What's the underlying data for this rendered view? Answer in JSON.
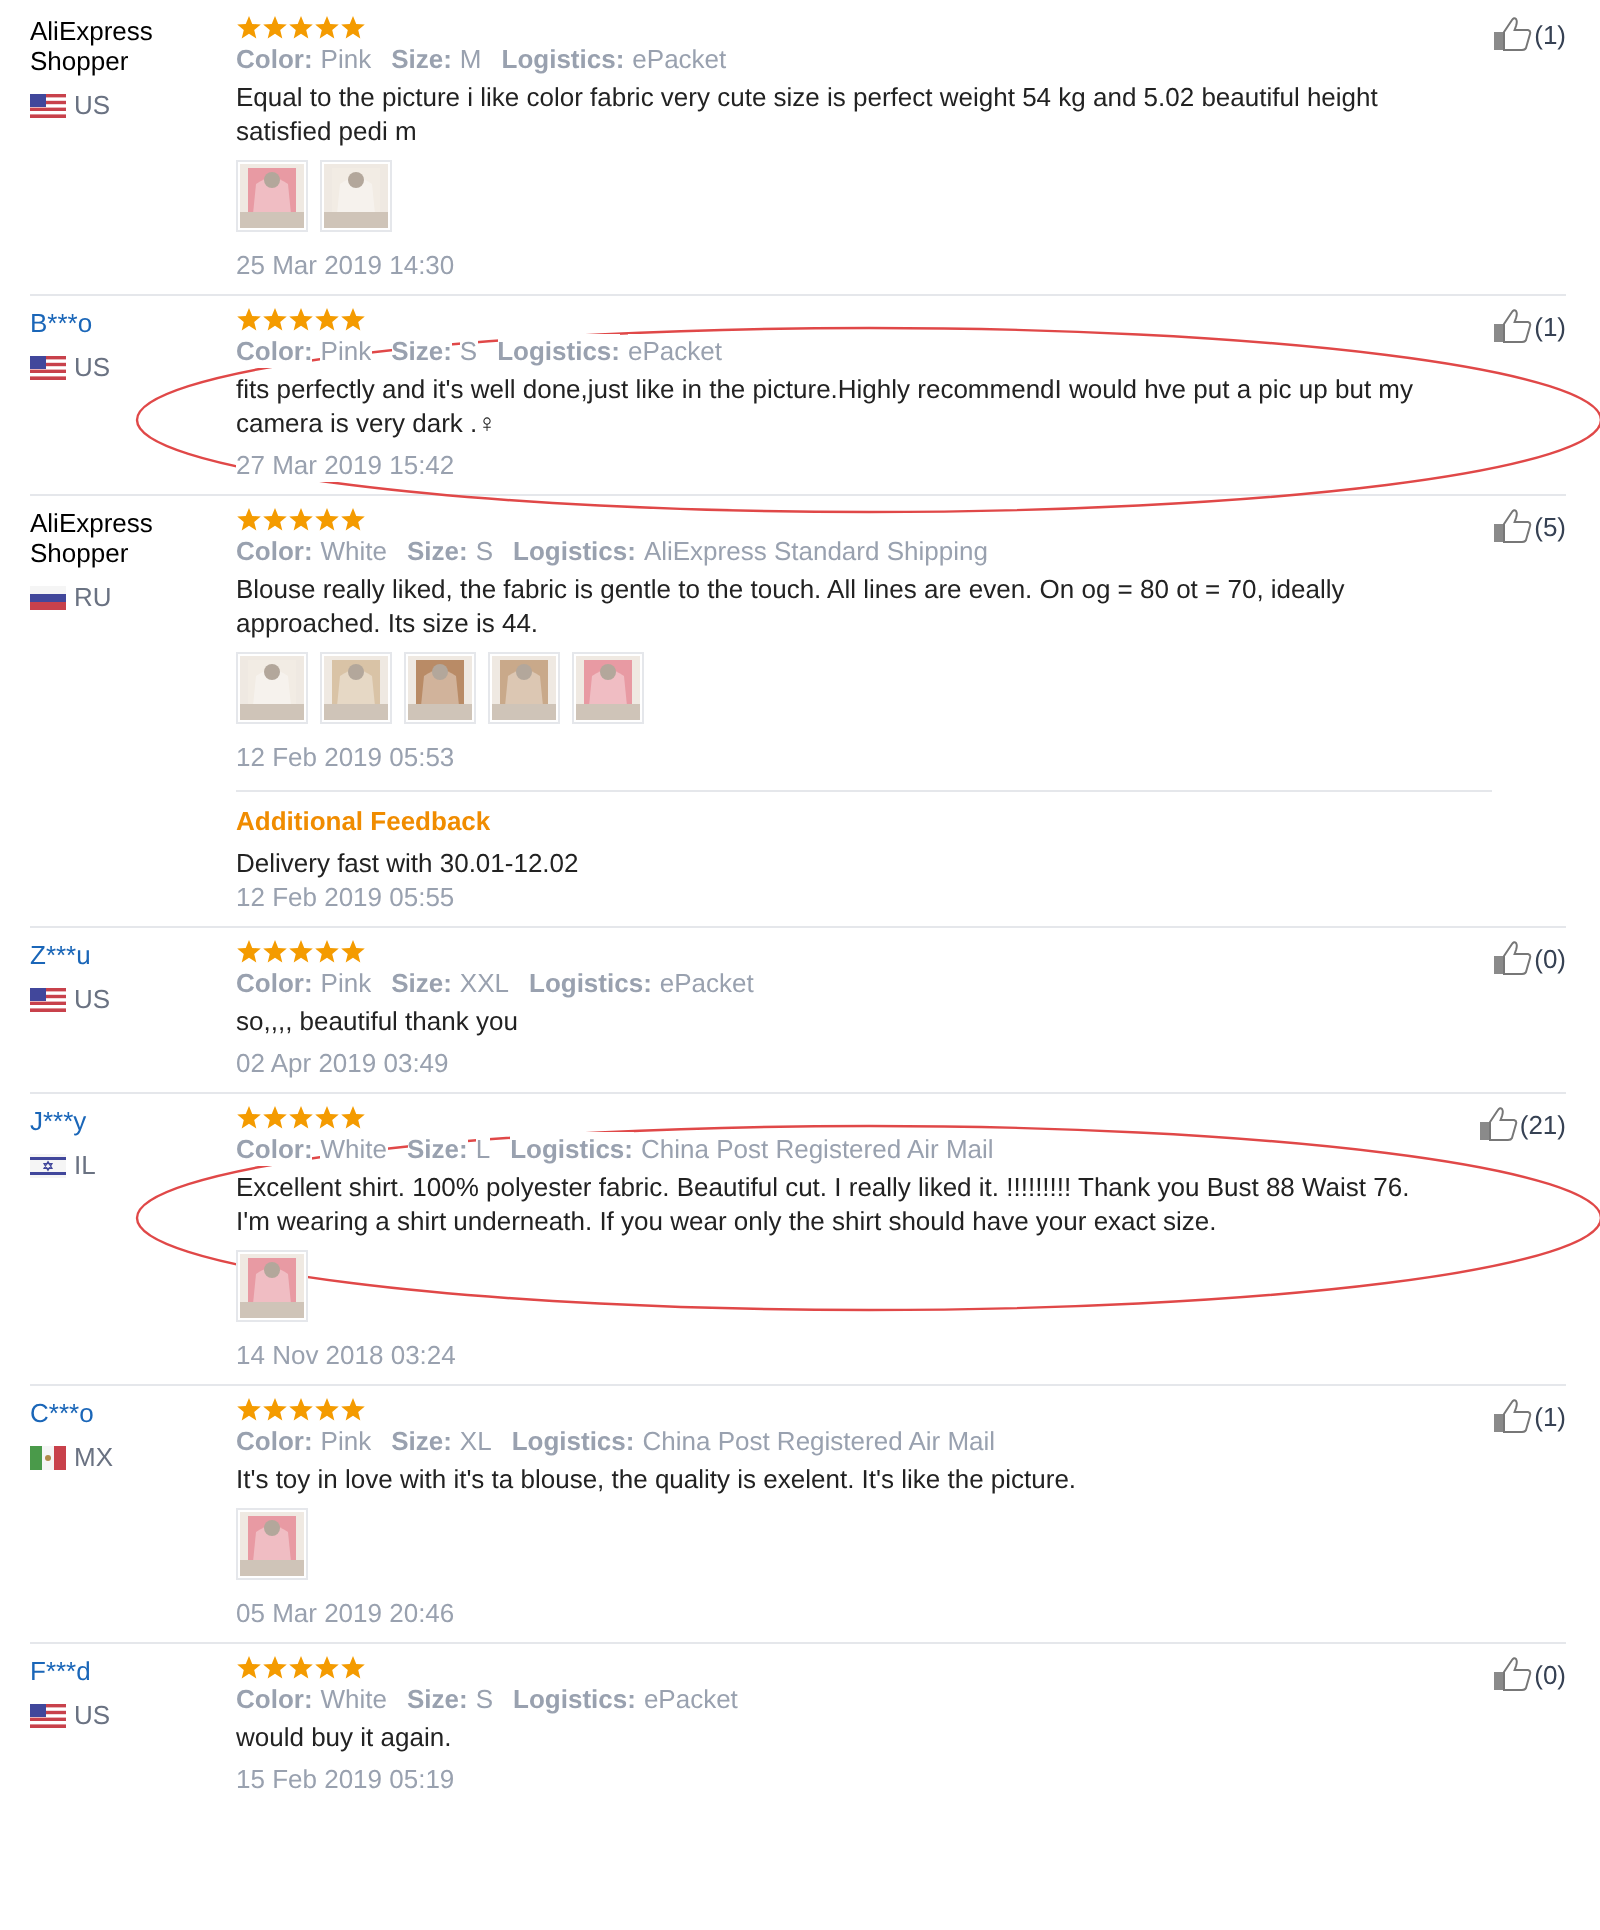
{
  "reviews": [
    {
      "name": "AliExpress Shopper",
      "masked": false,
      "flag": {
        "kind": "us"
      },
      "country": "US",
      "stars": 5,
      "color_label": "Color:",
      "color_option": "Pink",
      "size_label": "Size:",
      "size": "M",
      "logistics_label": "Logistics:",
      "logistics": "ePacket",
      "text": "Equal to the picture i like color fabric very cute size is perfect weight 54 kg and 5.02 beautiful height satisfied pedi m",
      "photos": [
        {
          "kind": "picture"
        },
        {
          "kind": "picture"
        }
      ],
      "date": "25 Mar 2019 14:30",
      "likes": "(1)",
      "circled": false
    },
    {
      "name": "B***o",
      "masked": true,
      "flag": {
        "kind": "us"
      },
      "country": "US",
      "stars": 5,
      "color_label": "Color:",
      "color_option": "Pink",
      "size_label": "Size:",
      "size": "S",
      "logistics_label": "Logistics:",
      "logistics": "ePacket",
      "text": "fits perfectly and it's well done,just like in the picture.Highly recommendI would hve put a pic up but my camera is very dark .♀",
      "date": "27 Mar 2019 15:42",
      "likes": "(1)",
      "circled": true
    },
    {
      "name": "AliExpress Shopper",
      "masked": false,
      "flag": {
        "kind": "ru"
      },
      "country": "RU",
      "stars": 5,
      "color_label": "Color:",
      "color_option": "White",
      "size_label": "Size:",
      "size": "S",
      "logistics_label": "Logistics:",
      "logistics": "AliExpress Standard Shipping",
      "text": "Blouse really liked, the fabric is gentle to the touch. All lines are even. On og = 80 ot = 70, ideally approached. Its size is 44.",
      "photos": [
        {
          "kind": "picture"
        },
        {
          "kind": "picture"
        },
        {
          "kind": "picture"
        },
        {
          "kind": "picture"
        },
        {
          "kind": "picture"
        }
      ],
      "date": "12 Feb 2019 05:53",
      "additional": {
        "title": "Additional Feedback",
        "text": "Delivery fast with 30.01-12.02",
        "date": "12 Feb 2019 05:55"
      },
      "likes": "(5)",
      "circled": false
    },
    {
      "name": "Z***u",
      "masked": true,
      "flag": {
        "kind": "us"
      },
      "country": "US",
      "stars": 5,
      "color_label": "Color:",
      "color_option": "Pink",
      "size_label": "Size:",
      "size": "XXL",
      "logistics_label": "Logistics:",
      "logistics": "ePacket",
      "text": "so,,,, beautiful thank you",
      "date": "02 Apr 2019 03:49",
      "likes": "(0)",
      "circled": false
    },
    {
      "name": "J***y",
      "masked": true,
      "flag": {
        "kind": "il"
      },
      "country": "IL",
      "stars": 5,
      "color_label": "Color:",
      "color_option": "White",
      "size_label": "Size:",
      "size": "L",
      "logistics_label": "Logistics:",
      "logistics": "China Post Registered Air Mail",
      "text": "Excellent shirt. 100% polyester fabric. Beautiful cut. I really liked it. !!!!!!!!! Thank you Bust 88 Waist 76. I'm wearing a shirt underneath. If you wear only the shirt should have your exact size.",
      "photos": [
        {
          "kind": "picture"
        }
      ],
      "date": "14 Nov 2018 03:24",
      "likes": "(21)",
      "circled": true
    },
    {
      "name": "C***o",
      "masked": true,
      "flag": {
        "kind": "mx"
      },
      "country": "MX",
      "stars": 5,
      "color_label": "Color:",
      "color_option": "Pink",
      "size_label": "Size:",
      "size": "XL",
      "logistics_label": "Logistics:",
      "logistics": "China Post Registered Air Mail",
      "text": "It's toy in love with it's ta blouse, the quality is exelent. It's like the picture.",
      "photos": [
        {
          "kind": "picture"
        }
      ],
      "date": "05 Mar 2019 20:46",
      "likes": "(1)",
      "circled": false
    },
    {
      "name": "F***d",
      "masked": true,
      "flag": {
        "kind": "us"
      },
      "country": "US",
      "stars": 5,
      "color_label": "Color:",
      "color_option": "White",
      "size_label": "Size:",
      "size": "S",
      "logistics_label": "Logistics:",
      "logistics": "ePacket",
      "text": "would buy it again.",
      "date": "15 Feb 2019 05:19",
      "likes": "(0)",
      "circled": false
    }
  ]
}
